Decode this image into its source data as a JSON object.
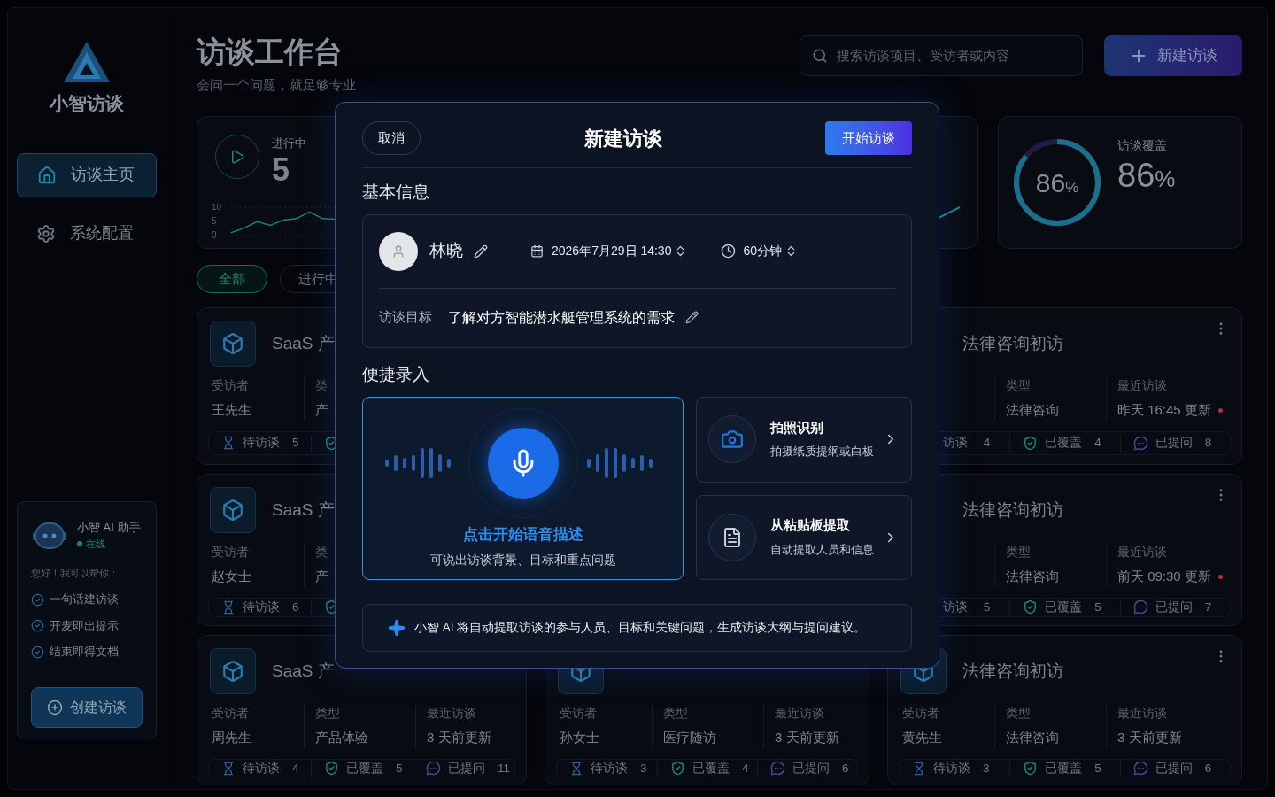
{
  "sidebar": {
    "brand": "小智访谈",
    "nav": [
      {
        "label": "访谈主页",
        "selected": true
      },
      {
        "label": "系统配置",
        "selected": false
      }
    ],
    "assistant": {
      "name": "小智 AI 助手",
      "status": "在线",
      "online": true,
      "greeting": "您好！我可以帮你：",
      "features": [
        "一句话建访谈",
        "开麦即出提示",
        "结束即得文档"
      ],
      "button": "创建访谈"
    }
  },
  "header": {
    "title": "访谈工作台",
    "subtitle": "会问一个问题，就足够专业",
    "search": {
      "placeholder": "搜索访谈项目、受访者或内容"
    },
    "new_button": "新建访谈"
  },
  "stats": [
    {
      "kind": "trend",
      "label": "进行中",
      "value": "5",
      "chart_data": {
        "type": "line",
        "ylim": [
          0,
          10
        ],
        "yticks": [
          10,
          5,
          0
        ],
        "series": [
          {
            "color": "#14b8a6",
            "values": [
              1.0,
              2.7,
              4.9,
              3.6,
              5.5,
              6.0,
              8.3,
              6.0,
              5.8
            ]
          }
        ]
      }
    },
    {
      "kind": "covered"
    },
    {
      "kind": "ring",
      "label": "访谈覆盖",
      "ring_value": "86",
      "ring_unit": "%",
      "value": "86",
      "unit": "%",
      "level": 0.86
    }
  ],
  "filters": [
    {
      "label": "全部",
      "selected": true
    },
    {
      "label": "进行中",
      "selected": false
    }
  ],
  "cards": [
    {
      "kind": "full",
      "title": "SaaS 产",
      "icon": true,
      "more": false,
      "fields": [
        {
          "kind": "field",
          "label": "受访者",
          "value": "王先生"
        },
        {
          "kind": "field",
          "label": "类",
          "value": "产"
        }
      ],
      "stats": [
        {
          "kind": "pending",
          "label": "待访谈",
          "count": "5"
        },
        {
          "kind": "covered"
        }
      ]
    },
    {
      "kind": "hidden"
    },
    {
      "kind": "full",
      "title": "法律咨询初访",
      "icon": false,
      "more": true,
      "fields": [
        {
          "kind": "hidden"
        },
        {
          "kind": "field",
          "label": "类型",
          "value": "法律咨询"
        },
        {
          "kind": "field",
          "label": "最近访谈",
          "value": "昨天 16:45 更新",
          "new": true
        }
      ],
      "stats": [
        {
          "kind": "cut",
          "label": "访谈",
          "count": "4"
        },
        {
          "kind": "covered",
          "label": "已覆盖",
          "count": "4"
        },
        {
          "kind": "asked",
          "label": "已提问",
          "count": "8"
        }
      ]
    },
    {
      "kind": "full",
      "title": "SaaS 产",
      "icon": true,
      "more": false,
      "fields": [
        {
          "kind": "field",
          "label": "受访者",
          "value": "赵女士"
        },
        {
          "kind": "field",
          "label": "类",
          "value": "产"
        }
      ],
      "stats": [
        {
          "kind": "pending",
          "label": "待访谈",
          "count": "6"
        },
        {
          "kind": "covered"
        }
      ]
    },
    {
      "kind": "hidden"
    },
    {
      "kind": "full",
      "title": "法律咨询初访",
      "icon": false,
      "more": true,
      "fields": [
        {
          "kind": "hidden"
        },
        {
          "kind": "field",
          "label": "类型",
          "value": "法律咨询"
        },
        {
          "kind": "field",
          "label": "最近访谈",
          "value": "前天 09:30 更新",
          "new": true
        }
      ],
      "stats": [
        {
          "kind": "cut",
          "label": "访谈",
          "count": "5"
        },
        {
          "kind": "covered",
          "label": "已覆盖",
          "count": "5"
        },
        {
          "kind": "asked",
          "label": "已提问",
          "count": "7"
        }
      ]
    },
    {
      "kind": "full",
      "title": "SaaS 产",
      "icon": true,
      "more": false,
      "fields": [
        {
          "kind": "field",
          "label": "受访者",
          "value": "周先生"
        },
        {
          "kind": "field",
          "label": "类型",
          "value": "产品体验"
        },
        {
          "kind": "field",
          "label": "最近访谈",
          "value": "3 天前更新",
          "new": false
        }
      ],
      "stats": [
        {
          "kind": "pending",
          "label": "待访谈",
          "count": "4"
        },
        {
          "kind": "covered",
          "label": "已覆盖",
          "count": "5"
        },
        {
          "kind": "asked",
          "label": "已提问",
          "count": "11"
        }
      ]
    },
    {
      "kind": "full",
      "icon": true,
      "more": false,
      "fields": [
        {
          "kind": "field",
          "label": "受访者",
          "value": "孙女士"
        },
        {
          "kind": "field",
          "label": "类型",
          "value": "医疗随访"
        },
        {
          "kind": "field",
          "label": "最近访谈",
          "value": "3 天前更新",
          "new": false
        }
      ],
      "stats": [
        {
          "kind": "pending",
          "label": "待访谈",
          "count": "3"
        },
        {
          "kind": "covered",
          "label": "已覆盖",
          "count": "4"
        },
        {
          "kind": "asked",
          "label": "已提问",
          "count": "6"
        }
      ]
    },
    {
      "kind": "full",
      "title": "法律咨询初访",
      "icon": true,
      "more": true,
      "fields": [
        {
          "kind": "field",
          "label": "受访者",
          "value": "黄先生"
        },
        {
          "kind": "field",
          "label": "类型",
          "value": "法律咨询"
        },
        {
          "kind": "field",
          "label": "最近访谈",
          "value": "3 天前更新",
          "new": false
        }
      ],
      "stats": [
        {
          "kind": "pending",
          "label": "待访谈",
          "count": "3"
        },
        {
          "kind": "covered",
          "label": "已覆盖",
          "count": "5"
        },
        {
          "kind": "asked",
          "label": "已提问",
          "count": "6"
        }
      ]
    }
  ],
  "dialog": {
    "cancel": "取消",
    "title": "新建访谈",
    "start": "开始访谈",
    "basic_title": "基本信息",
    "interviewee": "林晓",
    "datetime": "2026年7月29日 14:30",
    "duration": "60分钟",
    "goal_label": "访谈目标",
    "goal": "了解对方智能潜水艇管理系统的需求",
    "quick_title": "便捷录入",
    "voice": {
      "title": "点击开始语音描述",
      "hint": "可说出访谈背景、目标和重点问题",
      "selected": true
    },
    "options": [
      {
        "kind": "photo",
        "title": "拍照识别",
        "hint": "拍摄纸质提纲或白板"
      },
      {
        "kind": "clipboard",
        "title": "从粘贴板提取",
        "hint": "自动提取人员和信息"
      }
    ],
    "note": "小智 AI 将自动提取访谈的参与人员、目标和关键问题，生成访谈大纲与提问建议。"
  }
}
